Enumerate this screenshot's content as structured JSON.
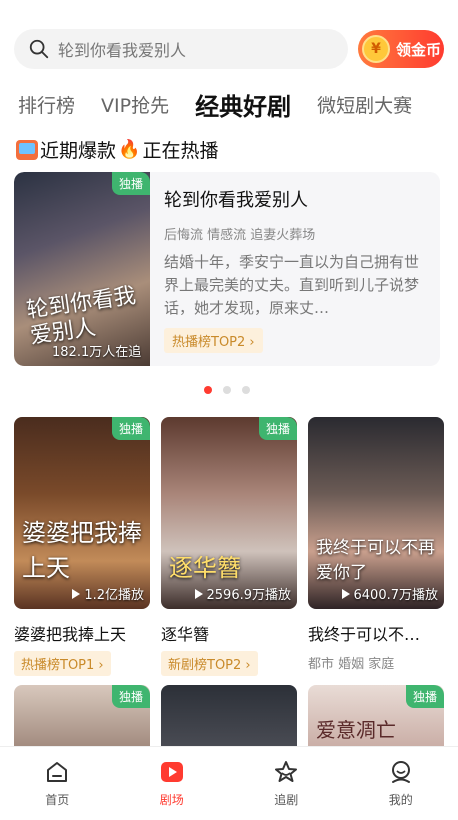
{
  "search": {
    "placeholder": "轮到你看我爱别人",
    "coin_label": "领金币",
    "coin_symbol": "¥"
  },
  "tabs": [
    {
      "label": "排行榜",
      "active": false
    },
    {
      "label": "VIP抢先",
      "active": false
    },
    {
      "label": "经典好剧",
      "active": true
    },
    {
      "label": "微短剧大赛",
      "active": false
    }
  ],
  "section": {
    "title_a": "近期爆款",
    "title_b": "正在热播"
  },
  "featured": {
    "badge": "独播",
    "poster_text": "轮到你看我爱别人",
    "views": "182.1万人在追",
    "title": "轮到你看我爱别人",
    "tags": "后悔流 情感流 追妻火葬场",
    "description": "结婚十年，季安宁一直以为自己拥有世界上最完美的丈夫。直到听到儿子说梦话，她才发现，原来丈…",
    "rank": "热播榜TOP2 ›"
  },
  "carousel": {
    "count": 3,
    "active_index": 0
  },
  "cards": [
    {
      "badge": "独播",
      "poster_text": "婆婆把我捧上天",
      "plays": "1.2亿播放",
      "title": "婆婆把我捧上天",
      "chip": "热播榜TOP1 ›"
    },
    {
      "badge": "独播",
      "poster_text": "逐华簪",
      "plays": "2596.9万播放",
      "title": "逐华簪",
      "chip": "新剧榜TOP2 ›"
    },
    {
      "badge": "",
      "poster_text": "我终于可以不再爱你了",
      "plays": "6400.7万播放",
      "title": "我终于可以不…",
      "tags": "都市 婚姻 家庭"
    }
  ],
  "cards_row2": [
    {
      "badge": "独播",
      "poster_text": ""
    },
    {
      "badge": "",
      "poster_text": ""
    },
    {
      "badge": "独播",
      "poster_text": "爱意凋亡"
    }
  ],
  "nav": [
    {
      "label": "首页",
      "icon": "home-icon",
      "active": false
    },
    {
      "label": "剧场",
      "icon": "play-icon",
      "active": true
    },
    {
      "label": "追剧",
      "icon": "star-icon",
      "active": false
    },
    {
      "label": "我的",
      "icon": "profile-icon",
      "active": false
    }
  ],
  "colors": {
    "accent": "#ff3b30",
    "badge": "#3fb56f",
    "chip_bg": "#fdf0dc",
    "chip_text": "#c98a2a"
  }
}
